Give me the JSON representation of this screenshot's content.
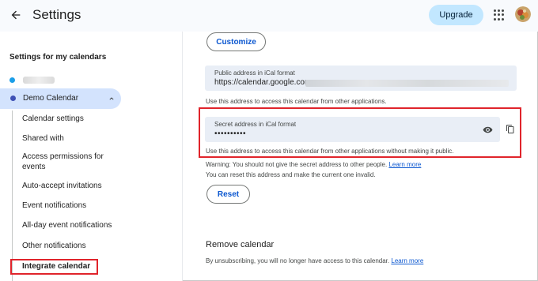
{
  "header": {
    "title": "Settings",
    "upgrade_label": "Upgrade",
    "back_icon": "arrow-back-icon",
    "apps_icon": "apps-grid-icon"
  },
  "sidebar": {
    "heading": "Settings for my calendars",
    "other_calendar_color": "#1a9ee8",
    "demo_calendar": {
      "label": "Demo Calendar",
      "color": "#3f51b5"
    },
    "items": [
      {
        "label": "Calendar settings"
      },
      {
        "label": "Shared with"
      },
      {
        "label": "Access permissions for events"
      },
      {
        "label": "Auto-accept invitations"
      },
      {
        "label": "Event notifications"
      },
      {
        "label": "All-day event notifications"
      },
      {
        "label": "Other notifications"
      },
      {
        "label": "Integrate calendar"
      }
    ]
  },
  "main": {
    "customize_label": "Customize",
    "public_ical": {
      "label": "Public address in iCal format",
      "value": "https://calendar.google.com",
      "hint": "Use this address to access this calendar from other applications."
    },
    "secret_ical": {
      "label": "Secret address in iCal format",
      "value": "••••••••••",
      "hint": "Use this address to access this calendar from other applications without making it public."
    },
    "warning_text": "Warning: You should not give the secret address to other people.",
    "warning_link": "Learn more",
    "reset_hint": "You can reset this address and make the current one invalid.",
    "reset_label": "Reset",
    "remove": {
      "title": "Remove calendar",
      "text": "By unsubscribing, you will no longer have access to this calendar.",
      "link": "Learn more"
    }
  },
  "colors": {
    "accent": "#0b57d0",
    "selected_bg": "#d3e3fd",
    "upgrade_bg": "#c2e7ff",
    "highlight_red": "#e0242b"
  }
}
